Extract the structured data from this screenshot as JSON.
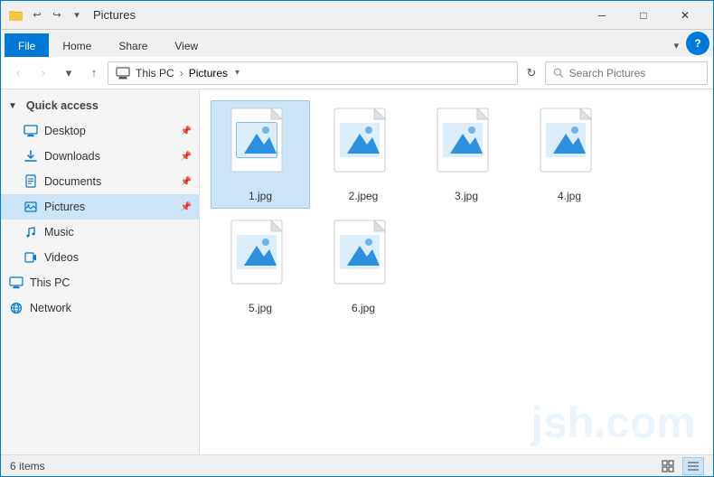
{
  "window": {
    "title": "Pictures",
    "titlebar_icon": "🗂️"
  },
  "titlebar": {
    "qat_buttons": [
      "↩",
      "↪",
      "▼"
    ],
    "title": "Pictures",
    "controls": {
      "minimize": "─",
      "maximize": "□",
      "close": "✕"
    }
  },
  "ribbon": {
    "tabs": [
      "File",
      "Home",
      "Share",
      "View"
    ],
    "active_tab": "File"
  },
  "addressbar": {
    "nav": {
      "back": "‹",
      "forward": "›",
      "dropdown": "▾",
      "up": "↑"
    },
    "path": {
      "this_pc": "This PC",
      "current": "Pictures"
    },
    "path_dropdown": "▾",
    "refresh": "↻",
    "search_placeholder": "Search Pictures"
  },
  "sidebar": {
    "sections": [
      {
        "id": "quick-access",
        "label": "Quick access",
        "items": [
          {
            "id": "desktop",
            "label": "Desktop",
            "pinned": true,
            "icon": "desktop"
          },
          {
            "id": "downloads",
            "label": "Downloads",
            "pinned": true,
            "icon": "download"
          },
          {
            "id": "documents",
            "label": "Documents",
            "pinned": true,
            "icon": "documents"
          },
          {
            "id": "pictures",
            "label": "Pictures",
            "pinned": true,
            "icon": "pictures",
            "active": true
          }
        ]
      },
      {
        "id": "music",
        "label": "Music",
        "pinned": false,
        "icon": "music"
      },
      {
        "id": "videos",
        "label": "Videos",
        "pinned": false,
        "icon": "videos"
      },
      {
        "id": "thispc",
        "label": "This PC",
        "pinned": false,
        "icon": "computer"
      },
      {
        "id": "network",
        "label": "Network",
        "pinned": false,
        "icon": "network"
      }
    ]
  },
  "files": [
    {
      "id": "file1",
      "name": "1.jpg",
      "selected": true
    },
    {
      "id": "file2",
      "name": "2.jpeg"
    },
    {
      "id": "file3",
      "name": "3.jpg"
    },
    {
      "id": "file4",
      "name": "4.jpg"
    },
    {
      "id": "file5",
      "name": "5.jpg"
    },
    {
      "id": "file6",
      "name": "6.jpg"
    }
  ],
  "statusbar": {
    "count": "6 items",
    "view_icons": [
      "▦",
      "≡"
    ]
  },
  "watermark": "jsh.com"
}
